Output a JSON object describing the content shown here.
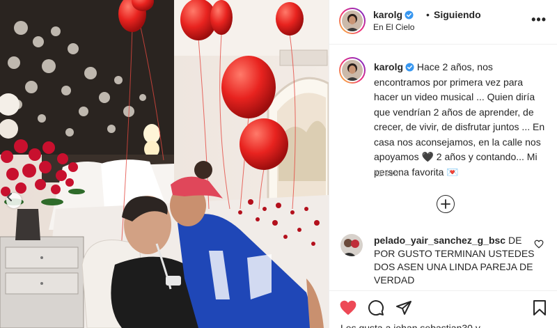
{
  "post": {
    "username": "karolg",
    "separator": "•",
    "follow_status": "Siguiendo",
    "location": "En El Cielo",
    "more_label": "•••",
    "caption": "Hace 2 años, nos encontramos por primera vez para hacer un video musical ... Quien diría que vendrían 2 años de aprender, de crecer, de vivir, de disfrutar juntos ... En casa nos aconsejamos, en la calle nos apoyamos 🖤 2 años y contando... Mi persona favorita 💌",
    "time_ago": "11 sem",
    "likes_text": "Les gusta a johan.sebastian30 y"
  },
  "comments": [
    {
      "username": "pelado_yair_sanchez_g_bsc",
      "text": "DE POR GUSTO TERMINAN USTEDES DOS ASEN UNA LINDA PAREJA DE VERDAD"
    }
  ],
  "icons": {
    "verified": "verified-badge-icon",
    "carousel_prev": "chevron-left-icon",
    "load_more": "plus-circle-icon",
    "comment_like": "heart-outline-icon",
    "like": "heart-filled-icon",
    "comment": "comment-bubble-icon",
    "share": "paper-plane-icon",
    "save": "bookmark-icon"
  },
  "colors": {
    "like_red": "#ed4956",
    "verified_blue": "#3897f0",
    "text_primary": "#262626",
    "text_secondary": "#8e8e8e",
    "border": "#efefef"
  }
}
